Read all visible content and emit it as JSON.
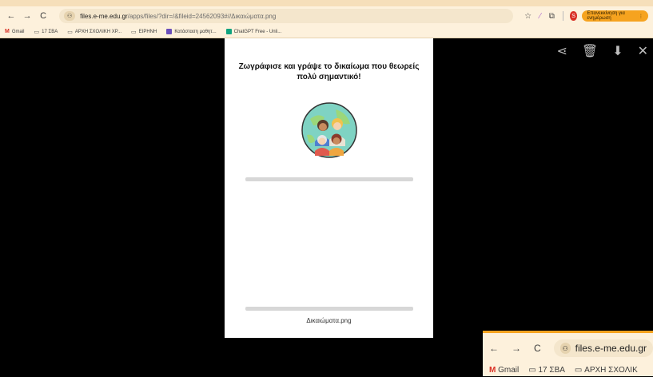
{
  "browser": {
    "url_host": "files.e-me.edu.gr",
    "url_path": "/apps/files/?dir=/&fileid=24562093#//Δικαιώματα.png",
    "update_label": "Επανεκκίνηση για ενημέρωση",
    "profile_initial": "S",
    "icons": {
      "back": "←",
      "forward": "→",
      "reload": "C",
      "site": "⚇",
      "star": "☆",
      "pen": "⁄",
      "extensions": "⧉",
      "menu": "⋮"
    }
  },
  "bookmarks": [
    {
      "label": "Gmail",
      "icon": "gmail-icon"
    },
    {
      "label": "17 ΣΒΑ",
      "icon": "folder-icon"
    },
    {
      "label": "ΑΡΧΗ ΣΧΟΛΙΚΗ ΧΡ...",
      "icon": "folder-icon"
    },
    {
      "label": "ΕΙΡΗΝΗ",
      "icon": "folder-icon"
    },
    {
      "label": "Κατάσταση μαθητ...",
      "icon": "sheet-icon"
    },
    {
      "label": "ChatGPT Free - Unli...",
      "icon": "chatgpt-icon"
    }
  ],
  "viewer": {
    "actions": {
      "share": "⋖",
      "delete": "🗑",
      "download": "⬇",
      "close": "✕"
    },
    "doc_title_line1": "Ζωγράφισε και γράψε το δικαίωμα που θεωρείς",
    "doc_title_line2": "πολύ σημαντικό!",
    "file_caption": "Δικαιώματα.png"
  },
  "nested_browser": {
    "url_text": "files.e-me.edu.gr",
    "bookmarks": [
      {
        "label": "Gmail"
      },
      {
        "label": "17 ΣΒΑ"
      },
      {
        "label": "ΑΡΧΗ ΣΧΟΛΙΚ"
      }
    ]
  },
  "colors": {
    "toolbar": "#fdf1dc",
    "accent": "#f6a31f",
    "viewer_bg": "#000000",
    "doc_bg": "#ffffff"
  }
}
